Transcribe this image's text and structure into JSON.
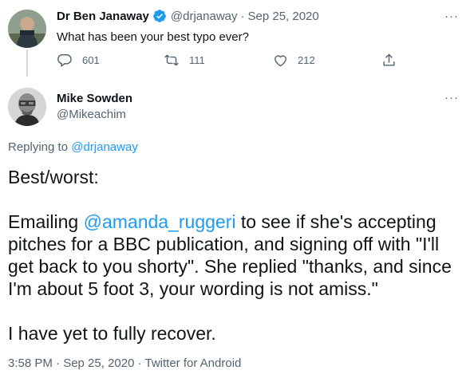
{
  "parent": {
    "author_name": "Dr Ben Janaway",
    "handle": "@drjanaway",
    "separator": "·",
    "date": "Sep 25, 2020",
    "text": "What has been your best typo ever?",
    "more": "···",
    "replies": "601",
    "retweets": "111",
    "likes": "212"
  },
  "reply": {
    "author_name": "Mike Sowden",
    "handle": "@Mikeachim",
    "more": "···",
    "replying_prefix": "Replying to",
    "replying_to": "@drjanaway",
    "line1": "Best/worst:",
    "para2_before": "Emailing ",
    "para2_mention": "@amanda_ruggeri",
    "para2_after": " to see if she's accepting pitches for a BBC publication, and signing off with \"I'll get back to you shorty\". She replied \"thanks, and since I'm about 5 foot 3, your wording is not amiss.\"",
    "line3": "I have yet to fully recover.",
    "timestamp": "3:58 PM · Sep 25, 2020 · Twitter for Android"
  },
  "colors": {
    "accent": "#1d9bf0",
    "muted": "#536471",
    "text": "#0f1419"
  },
  "icons": [
    "verified-badge-icon",
    "reply-icon",
    "retweet-icon",
    "like-icon",
    "share-icon"
  ]
}
